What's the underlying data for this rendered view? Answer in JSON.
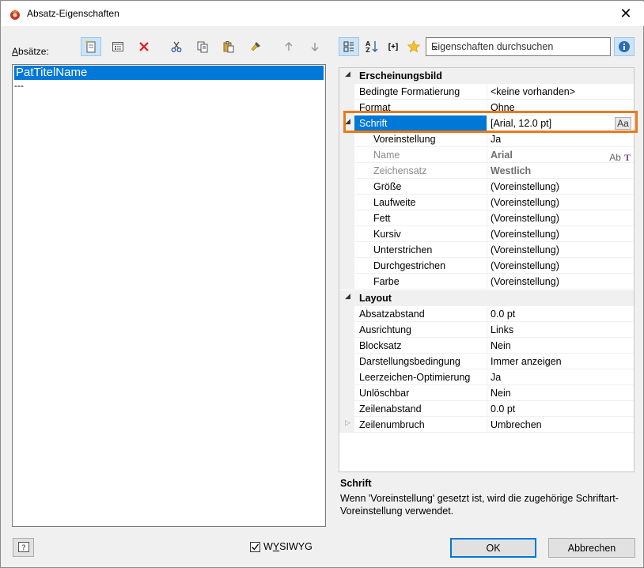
{
  "window": {
    "title": "Absatz-Eigenschaften",
    "close_glyph": "✕"
  },
  "left_panel": {
    "label_prefix": "A",
    "label_rest": "bsätze:",
    "toolbar": {
      "new_icon": "new-paragraph-icon",
      "properties_icon": "properties-icon",
      "delete_icon": "delete-icon",
      "cut_icon": "cut-icon",
      "copy_icon": "copy-icon",
      "paste_icon": "paste-icon",
      "format_brush_icon": "format-brush-icon",
      "move_up_icon": "move-up-icon",
      "move_down_icon": "move-down-icon"
    },
    "items": [
      {
        "label": "PatTitelName",
        "selected": true
      },
      {
        "label": "---",
        "selected": false
      }
    ]
  },
  "right_panel": {
    "toolbar": {
      "categorized_icon": "categorized-icon",
      "sort_az_icon": "sort-az-icon",
      "expand_icon_text": "[+]",
      "favorite_icon": "star-icon"
    },
    "search_placeholder": "Eigenschaften durchsuchen",
    "info_icon": "info-icon",
    "categories": [
      {
        "name": "Erscheinungsbild",
        "rows": [
          {
            "name": "Bedingte Formatierung",
            "value": "<keine vorhanden>"
          },
          {
            "name": "Format",
            "value": "Ohne"
          },
          {
            "name": "Schrift",
            "value": "[Arial, 12.0 pt]",
            "button": "Aa",
            "selected": true
          },
          {
            "name": "Voreinstellung",
            "value": "Ja",
            "indent": true
          },
          {
            "name": "Name",
            "value": "Arial",
            "indent": true,
            "disabled": true,
            "font_icons": [
              "Ab",
              "T"
            ]
          },
          {
            "name": "Zeichensatz",
            "value": "Westlich",
            "indent": true,
            "disabled": true
          },
          {
            "name": "Größe",
            "value": "(Voreinstellung)",
            "indent": true
          },
          {
            "name": "Laufweite",
            "value": "(Voreinstellung)",
            "indent": true
          },
          {
            "name": "Fett",
            "value": "(Voreinstellung)",
            "indent": true
          },
          {
            "name": "Kursiv",
            "value": "(Voreinstellung)",
            "indent": true
          },
          {
            "name": "Unterstrichen",
            "value": "(Voreinstellung)",
            "indent": true
          },
          {
            "name": "Durchgestrichen",
            "value": "(Voreinstellung)",
            "indent": true
          },
          {
            "name": "Farbe",
            "value": "(Voreinstellung)",
            "indent": true
          }
        ]
      },
      {
        "name": "Layout",
        "rows": [
          {
            "name": "Absatzabstand",
            "value": "0.0 pt"
          },
          {
            "name": "Ausrichtung",
            "value": "Links"
          },
          {
            "name": "Blocksatz",
            "value": "Nein"
          },
          {
            "name": "Darstellungsbedingung",
            "value": "Immer anzeigen"
          },
          {
            "name": "Leerzeichen-Optimierung",
            "value": "Ja"
          },
          {
            "name": "Unlöschbar",
            "value": "Nein"
          },
          {
            "name": "Zeilenabstand",
            "value": "0.0 pt"
          },
          {
            "name": "Zeilenumbruch",
            "value": "Umbrechen",
            "collapsed": true
          }
        ]
      }
    ],
    "description": {
      "title": "Schrift",
      "text": "Wenn 'Voreinstellung' gesetzt ist, wird die zugehörige Schriftart-Voreinstellung verwendet."
    }
  },
  "footer": {
    "help_glyph": "?",
    "wysiwyg_pre": "W",
    "wysiwyg_underlined": "Y",
    "wysiwyg_post": "SIWYG",
    "wysiwyg_checked": true,
    "ok_label": "OK",
    "cancel_label": "Abbrechen"
  },
  "colors": {
    "selection": "#0078d7",
    "highlight": "#e97a1a",
    "delete_red": "#e81123"
  }
}
